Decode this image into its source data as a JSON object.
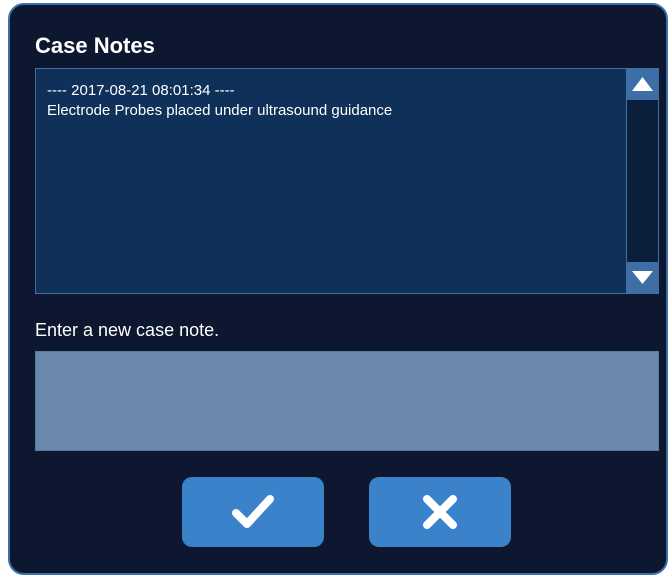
{
  "dialog": {
    "title": "Case Notes",
    "notes": [
      "---- 2017-08-21 08:01:34 ----",
      "Electrode Probes placed under ultrasound guidance"
    ],
    "scroll_up_icon": "triangle-up-icon",
    "scroll_down_icon": "triangle-down-icon",
    "prompt": "Enter a new case note.",
    "input_value": "",
    "input_placeholder": "",
    "confirm_icon": "checkmark-icon",
    "cancel_icon": "x-icon"
  },
  "colors": {
    "background": "#0d1730",
    "border": "#3a6fa8",
    "notes_bg": "#0f3058",
    "input_bg": "#6a87ad",
    "button_bg": "#3a83cb"
  }
}
